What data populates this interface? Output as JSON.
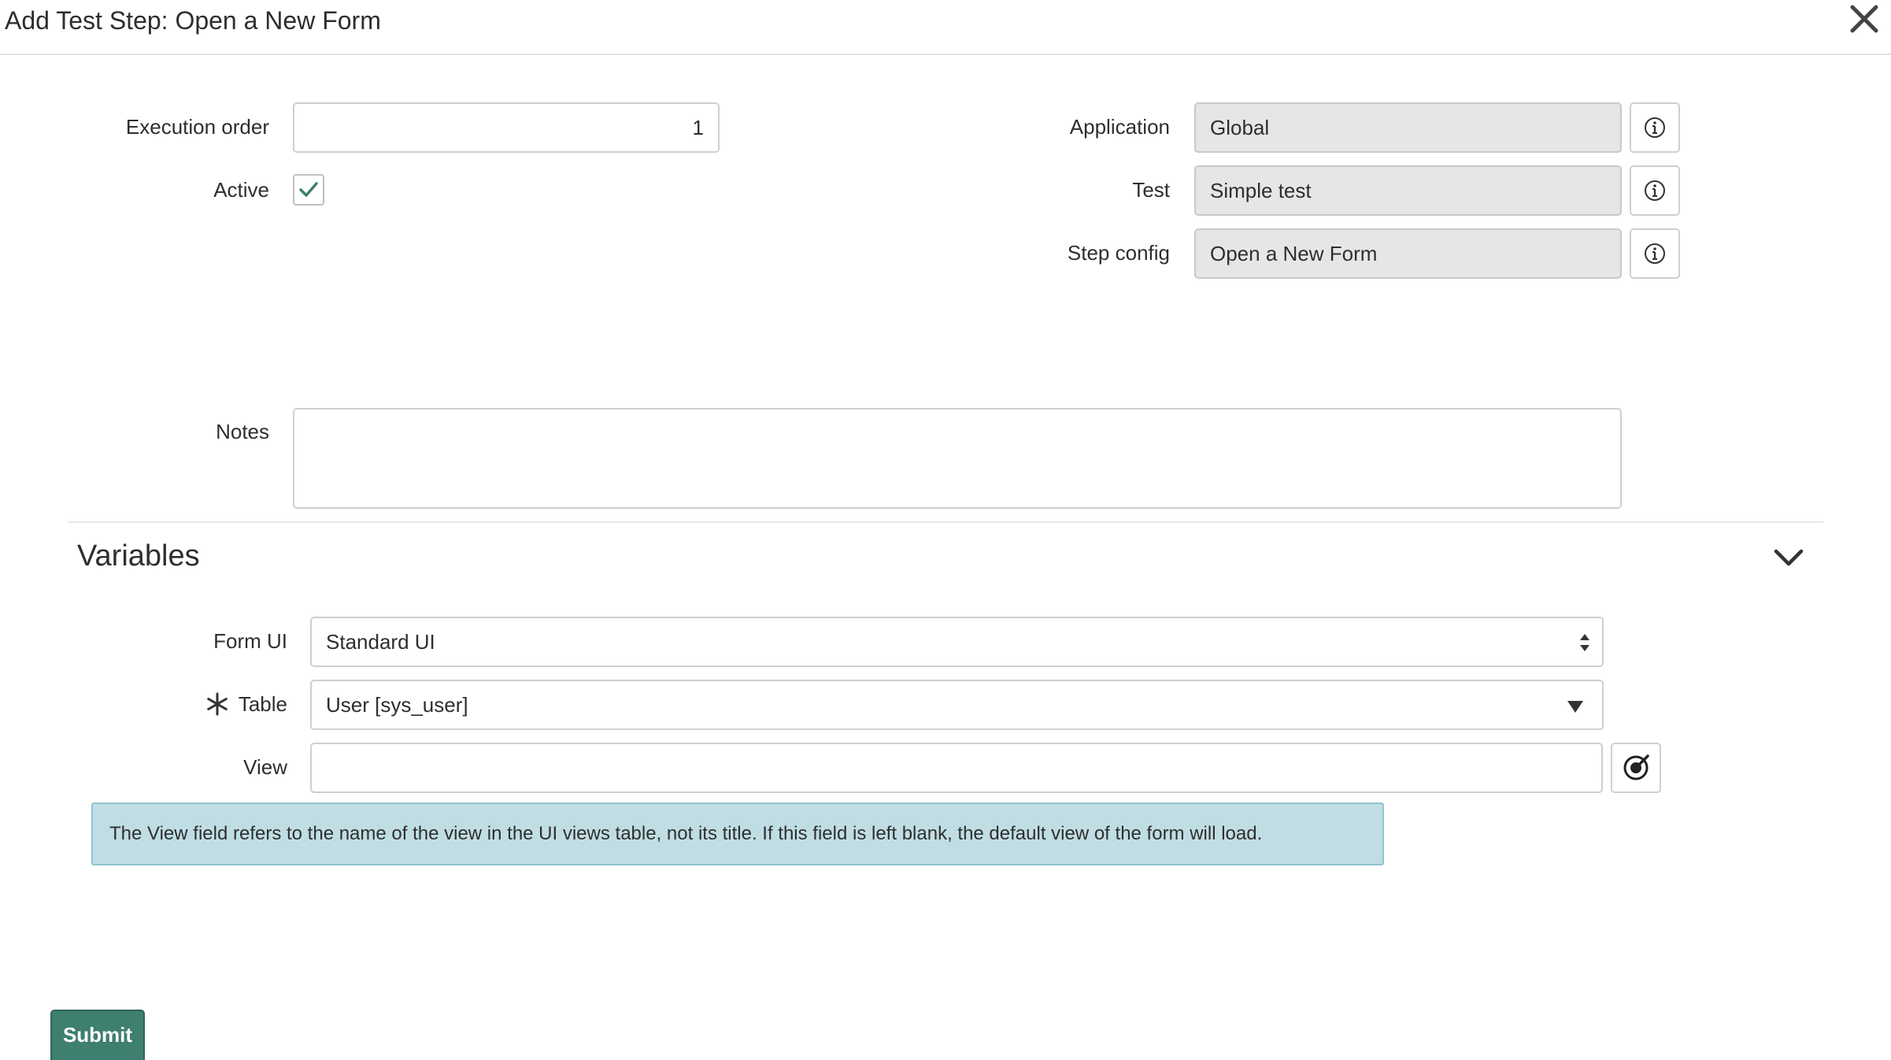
{
  "header": {
    "title": "Add Test Step: Open a New Form"
  },
  "form": {
    "execution_order": {
      "label": "Execution order",
      "value": "1"
    },
    "active": {
      "label": "Active",
      "checked": true
    },
    "application": {
      "label": "Application",
      "value": "Global"
    },
    "test": {
      "label": "Test",
      "value": "Simple test"
    },
    "step_config": {
      "label": "Step config",
      "value": "Open a New Form"
    },
    "notes": {
      "label": "Notes",
      "value": ""
    }
  },
  "variables": {
    "title": "Variables",
    "form_ui": {
      "label": "Form UI",
      "value": "Standard UI"
    },
    "table": {
      "label": "Table",
      "value": "User [sys_user]",
      "required": true
    },
    "view": {
      "label": "View",
      "value": ""
    },
    "info_message": "The View field refers to the name of the view in the UI views table, not its title. If this field is left blank, the default view of the form will load."
  },
  "actions": {
    "submit_label": "Submit"
  },
  "colors": {
    "accent": "#3f7f6f",
    "readonly_bg": "#e6e6e6",
    "info_bg": "#c0dde4",
    "info_border": "#8fc4d1"
  },
  "icons": {
    "close": "close-icon",
    "info": "info-icon",
    "checkmark": "checkmark-icon",
    "chevron": "chevron-down-icon",
    "select": "select-arrows-icon",
    "dropdown": "dropdown-arrow-icon",
    "required": "required-asterisk-icon",
    "reference": "reference-lookup-icon"
  }
}
